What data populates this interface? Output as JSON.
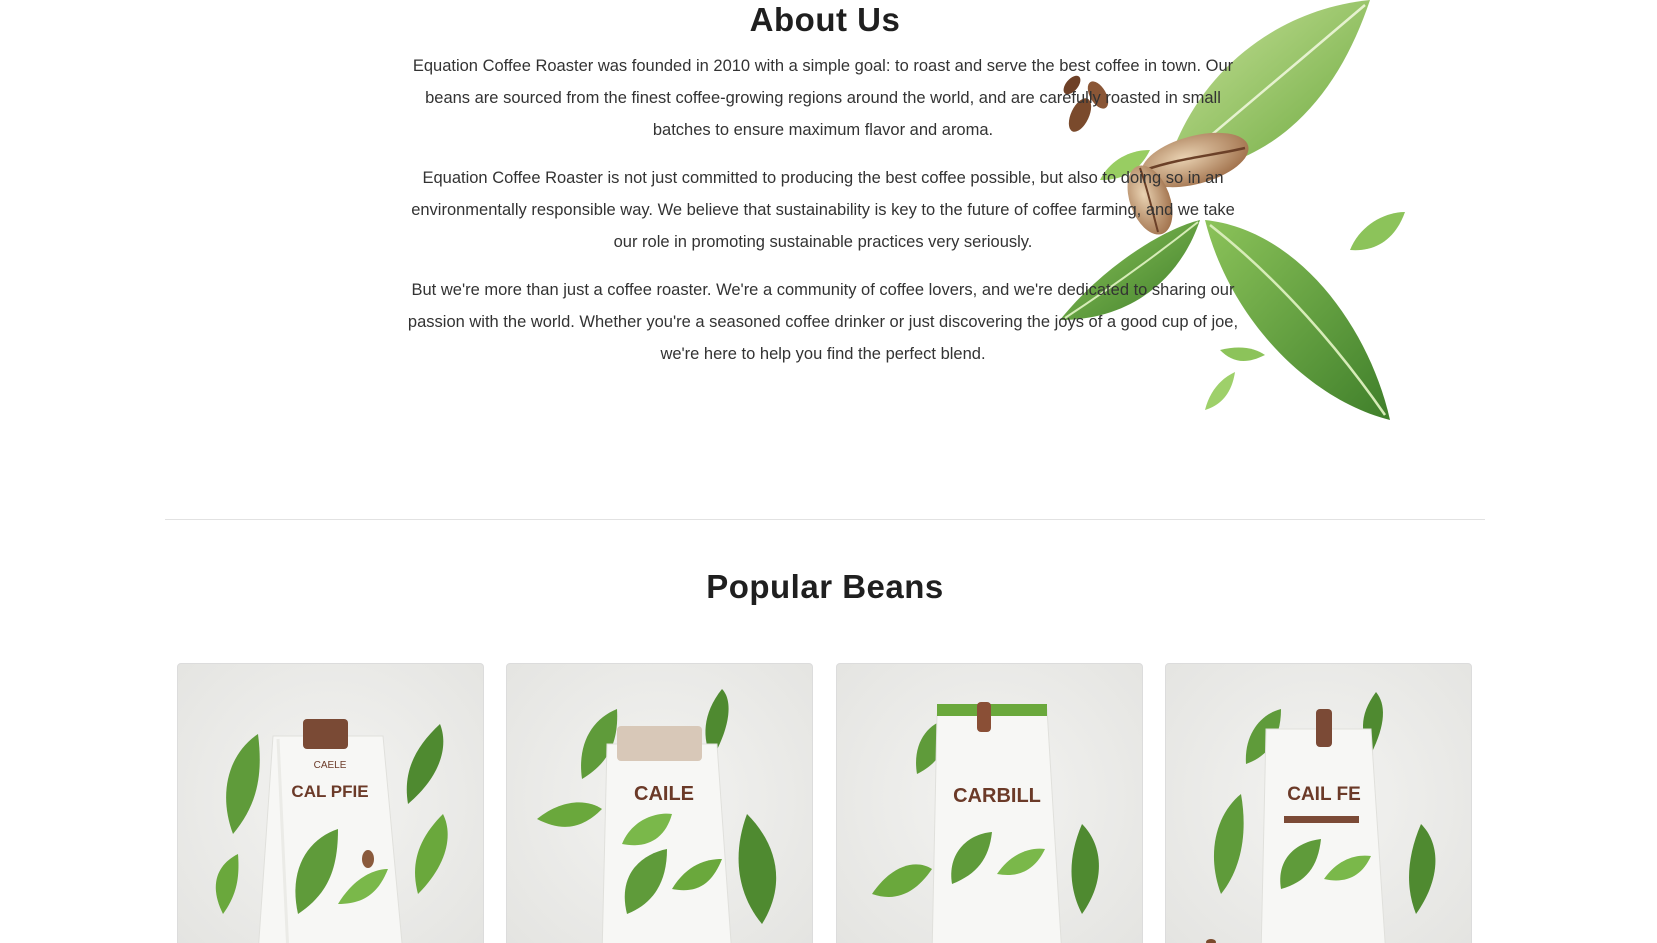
{
  "about": {
    "title": "About Us",
    "paragraphs": [
      "Equation Coffee Roaster was founded in 2010 with a simple goal: to roast and serve the best coffee in town. Our beans are sourced from the finest coffee-growing regions around the world, and are carefully roasted in small batches to ensure maximum flavor and aroma.",
      "Equation Coffee Roaster is not just committed to producing the best coffee possible, but also to doing so in an environmentally responsible way. We believe that sustainability is key to the future of coffee farming, and we take our role in promoting sustainable practices very seriously.",
      "But we're more than just a coffee roaster. We're a community of coffee lovers, and we're dedicated to sharing our passion with the world. Whether you're a seasoned coffee drinker or just discovering the joys of a good cup of joe, we're here to help you find the perfect blend."
    ]
  },
  "beans": {
    "title": "Popular Beans",
    "products": [
      {
        "bag_text": "CAL PFIE",
        "bag_subtext": "CAELE",
        "clip_color": "#7a4a35"
      },
      {
        "bag_text": "CAILE",
        "bag_subtext": "",
        "clip_color": "#cbb6a2"
      },
      {
        "bag_text": "CARBILL",
        "bag_subtext": "",
        "clip_color": "#8a4f36"
      },
      {
        "bag_text": "CAIL FE",
        "bag_subtext": "",
        "clip_color": "#7b4a36"
      }
    ]
  },
  "colors": {
    "leaf": "#5f9b3a",
    "leaf_light": "#8cc35a",
    "bean": "#8a5a3c",
    "heading": "#1f1f1f",
    "body_text": "#333333"
  }
}
